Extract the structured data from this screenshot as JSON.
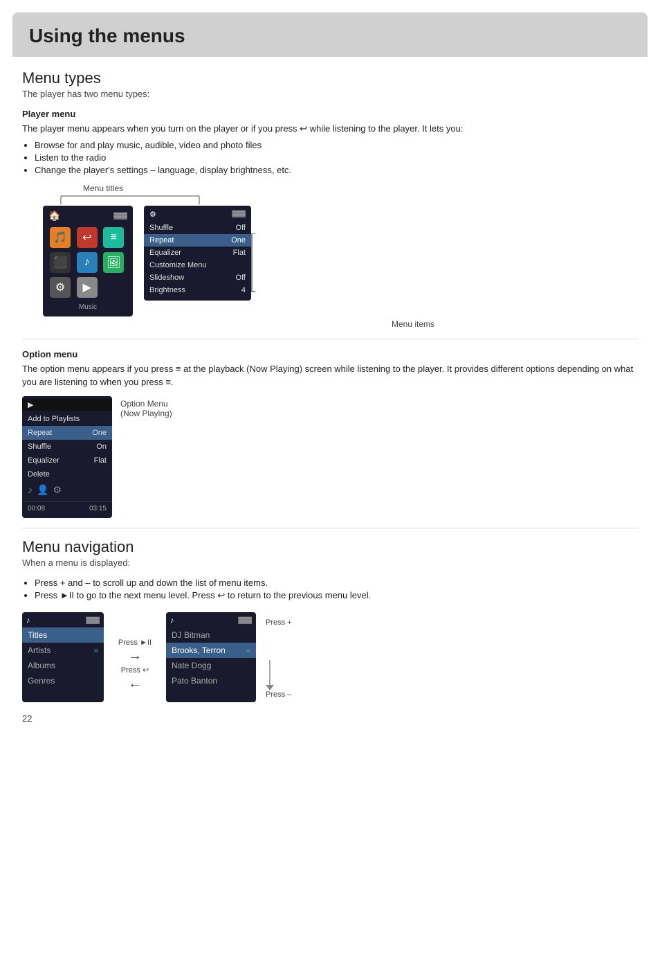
{
  "header": {
    "title": "Using the menus"
  },
  "menu_types": {
    "section_title": "Menu types",
    "subtitle": "The player has two menu types:",
    "player_menu": {
      "label": "Player menu",
      "description": "The player menu appears when you turn on the player or if you press",
      "description2": "while listening to the player. It lets you:",
      "bullets": [
        "Browse for and play music, audible, video and photo files",
        "Listen to the radio",
        "Change the player's settings – language, display brightness, etc."
      ],
      "diagram_label": "Menu titles",
      "menu_items_label": "Menu items",
      "device1": {
        "label": "Music",
        "battery": "▓▓▓"
      },
      "settings_menu": {
        "rows": [
          {
            "label": "Shuffle",
            "value": "Off"
          },
          {
            "label": "Repeat",
            "value": "One",
            "highlighted": true
          },
          {
            "label": "Equalizer",
            "value": "Flat"
          },
          {
            "label": "Customize Menu",
            "value": ""
          },
          {
            "label": "Slideshow",
            "value": "Off"
          },
          {
            "label": "Brightness",
            "value": "4"
          }
        ]
      }
    },
    "option_menu": {
      "label": "Option menu",
      "description": "The option menu appears if you press",
      "description2": "at the playback (Now Playing) screen while listening to the player. It provides different options depending on what you are listening to when you press",
      "device": {
        "rows": [
          {
            "label": "Add to Playlists",
            "value": ""
          },
          {
            "label": "Repeat",
            "value": "One",
            "highlighted": true
          },
          {
            "label": "Shuffle",
            "value": "On"
          },
          {
            "label": "Equalizer",
            "value": "Flat"
          },
          {
            "label": "Delete",
            "value": ""
          }
        ],
        "time_start": "00:08",
        "time_end": "03:15"
      },
      "caption": "Option Menu\n(Now Playing)"
    }
  },
  "menu_navigation": {
    "section_title": "Menu navigation",
    "subtitle": "When a menu is displayed:",
    "bullets": [
      "Press + and – to scroll up and down the list of menu items.",
      "Press ►II to go to the next menu level. Press ↩ to return to the previous menu level."
    ],
    "diagram": {
      "screen1": {
        "rows": [
          {
            "label": "Titles",
            "highlighted": true
          },
          {
            "label": "Artists",
            "value": ">>"
          },
          {
            "label": "Albums"
          },
          {
            "label": "Genres"
          }
        ]
      },
      "press_forward": "Press ►II",
      "press_back": "Press ↩",
      "screen2": {
        "rows": [
          {
            "label": "DJ Bitman"
          },
          {
            "label": "Brooks, Terron",
            "value": ">>",
            "highlighted": true
          },
          {
            "label": "Nate Dogg"
          },
          {
            "label": "Pato Banton"
          }
        ]
      },
      "press_plus": "Press +",
      "press_minus": "Press –"
    }
  },
  "page_number": "22"
}
